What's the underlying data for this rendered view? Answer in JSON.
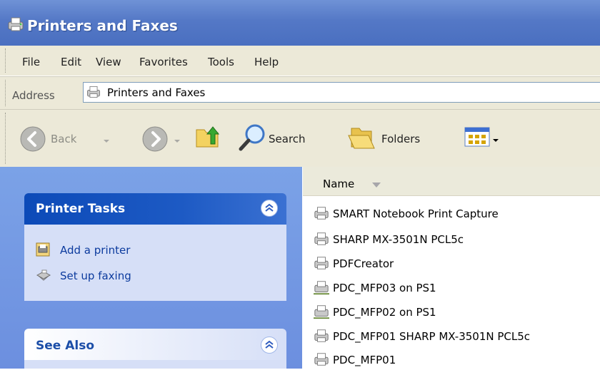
{
  "window": {
    "title": "Printers and Faxes"
  },
  "menu": [
    "File",
    "Edit",
    "View",
    "Favorites",
    "Tools",
    "Help"
  ],
  "address": {
    "label": "Address",
    "value": "Printers and Faxes"
  },
  "toolbar": {
    "back": "Back",
    "search": "Search",
    "folders": "Folders"
  },
  "printer_tasks": {
    "title": "Printer Tasks",
    "items": [
      "Add a printer",
      "Set up faxing"
    ]
  },
  "see_also": {
    "title": "See Also"
  },
  "list": {
    "column": "Name",
    "items": [
      "SMART Notebook Print Capture",
      "SHARP MX-3501N PCL5c",
      "PDFCreator",
      "PDC_MFP03 on PS1",
      "PDC_MFP02 on PS1",
      "PDC_MFP01 SHARP MX-3501N PCL5c",
      "PDC_MFP01"
    ]
  },
  "colors": {
    "titlebar": "#4a6fc0",
    "task_panel_header": "#0c4ab8",
    "task_link": "#0c3b9e",
    "sidebar": "#7ba2e7"
  },
  "icons": {
    "window": "printer-icon",
    "back": "back-arrow-icon",
    "forward": "forward-arrow-icon",
    "up": "folder-up-icon",
    "search": "search-icon",
    "folders": "folders-icon",
    "views": "views-icon"
  }
}
